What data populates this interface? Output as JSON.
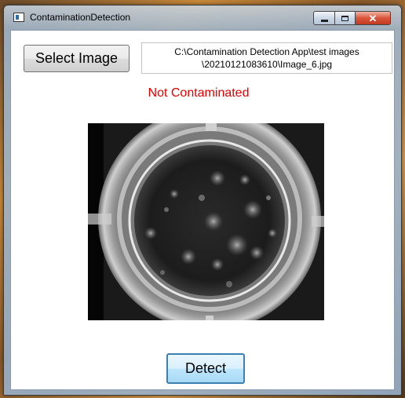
{
  "window": {
    "title": "ContaminationDetection"
  },
  "toolbar": {
    "select_label": "Select Image"
  },
  "file": {
    "path_line1": "C:\\Contamination Detection App\\test images",
    "path_line2": "\\20210121083610\\Image_6.jpg"
  },
  "result": {
    "status": "Not Contaminated",
    "status_color": "#e00000"
  },
  "preview": {
    "description_icon": "petri-dish-image"
  },
  "actions": {
    "detect_label": "Detect"
  },
  "icons": {
    "close": "close-icon",
    "minimize": "minimize-icon",
    "maximize": "maximize-icon",
    "app": "app-icon"
  }
}
